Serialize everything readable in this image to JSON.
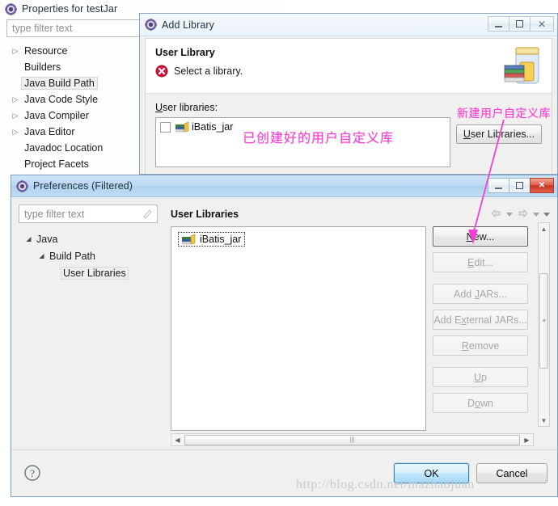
{
  "properties_window": {
    "title": "Properties for testJar",
    "icon": "eclipse-icon",
    "filter": {
      "placeholder": "type filter text",
      "value": ""
    },
    "tree_items": [
      {
        "label": "Resource",
        "expandable": true,
        "selected": false
      },
      {
        "label": "Builders",
        "expandable": false,
        "selected": false
      },
      {
        "label": "Java Build Path",
        "expandable": false,
        "selected": true
      },
      {
        "label": "Java Code Style",
        "expandable": true,
        "selected": false
      },
      {
        "label": "Java Compiler",
        "expandable": true,
        "selected": false
      },
      {
        "label": "Java Editor",
        "expandable": true,
        "selected": false
      },
      {
        "label": "Javadoc Location",
        "expandable": false,
        "selected": false
      },
      {
        "label": "Project Facets",
        "expandable": false,
        "selected": false
      }
    ]
  },
  "add_library_window": {
    "title": "Add Library",
    "icon": "eclipse-icon",
    "window_buttons": {
      "minimize": "–",
      "maximize": "□",
      "close": "✕"
    },
    "header": {
      "title": "User Library",
      "message": "Select a library.",
      "message_icon": "error-icon",
      "decoration_icon": "library-jar-icon"
    },
    "user_libraries_label": "User libraries:",
    "libraries": [
      {
        "name": "iBatis_jar",
        "checked": false,
        "icon": "library-icon"
      }
    ],
    "user_libraries_button": "User Libraries..."
  },
  "preferences_window": {
    "title": "Preferences (Filtered)",
    "icon": "eclipse-icon",
    "window_buttons": {
      "minimize": "–",
      "maximize": "□",
      "close": "✕"
    },
    "filter": {
      "placeholder": "type filter text",
      "value": "",
      "clear_icon": "clear-icon"
    },
    "tree_items": [
      {
        "label": "Java",
        "level": 0,
        "expanded": true,
        "selected": false
      },
      {
        "label": "Build Path",
        "level": 1,
        "expanded": true,
        "selected": false
      },
      {
        "label": "User Libraries",
        "level": 2,
        "expanded": false,
        "selected": true
      }
    ],
    "page_title": "User Libraries",
    "nav": {
      "back_icon": "back-icon",
      "forward_icon": "forward-icon",
      "menu_icon": "chevron-down-icon"
    },
    "list_items": [
      {
        "name": "iBatis_jar",
        "icon": "library-icon",
        "selected": true
      }
    ],
    "buttons": [
      {
        "label": "New...",
        "mnemonic": "N",
        "enabled": true,
        "focused": true
      },
      {
        "label": "Edit...",
        "mnemonic": "E",
        "enabled": false,
        "focused": false
      },
      {
        "label": "Add JARs...",
        "mnemonic": "J",
        "enabled": false,
        "focused": false
      },
      {
        "label": "Add External JARs...",
        "mnemonic": "x",
        "enabled": false,
        "focused": false
      },
      {
        "label": "Remove",
        "mnemonic": "R",
        "enabled": false,
        "focused": false
      },
      {
        "label": "Up",
        "mnemonic": "U",
        "enabled": false,
        "focused": false
      },
      {
        "label": "Down",
        "mnemonic": "o",
        "enabled": false,
        "focused": false
      }
    ],
    "help_icon": "help-icon",
    "footer_buttons": {
      "ok": "OK",
      "cancel": "Cancel"
    },
    "scrollbars": {
      "vertical": "vertical-scrollbar",
      "horizontal": "horizontal-scrollbar"
    }
  },
  "annotations": {
    "existing_library": "已创建好的用户自定义库",
    "new_library": "新建用户自定义库",
    "color": "#f43fd0"
  },
  "watermark": "http://blog.csdn.net/mazhaojuan"
}
